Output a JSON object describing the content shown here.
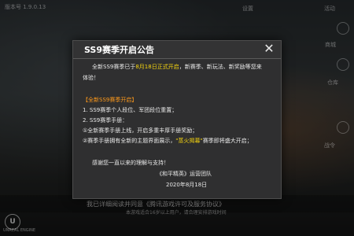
{
  "background": {
    "version_text": "版本号 1.9.0.13",
    "corner_labels": [
      "设置",
      "活动",
      "商城",
      "仓库",
      "战令"
    ],
    "tip_text": "我已详细阅读并同意《腾讯游戏许可及服务协议》",
    "tip_sub": "本游戏适合16岁以上用户，请合理安排游戏时间",
    "engine_text": "UNREAL ENGINE"
  },
  "dialog": {
    "title": "SS9赛季开启公告",
    "close_glyph": "✕",
    "intro_1_pre": "全新SS9赛季已于",
    "intro_1_highlight": "8月18日正式开启",
    "intro_1_post": "，新赛季、新玩法、新奖励等您来",
    "intro_2": "体验！",
    "section_title": "【全新SS9赛季开启】",
    "item_1": "1. SS9赛季个人段位、军团段位重置；",
    "item_2": "2. SS9赛季手册：",
    "item_2a": "①全新赛季手册上线，开启多重丰厚手册奖励；",
    "item_2b_pre": "②赛季手册拥有全新的主题界面展示，",
    "item_2b_highlight": "\"蒸火揭幕\"",
    "item_2b_post": "赛季即将盛大开启；",
    "thanks": "感谢您一直以来的理解与支持！",
    "signature": "《和平精英》运营团队",
    "date": "2020年8月18日"
  },
  "colors": {
    "highlight": "#f0c419",
    "section": "#ff9a1a",
    "panel": "#2f2f30"
  }
}
